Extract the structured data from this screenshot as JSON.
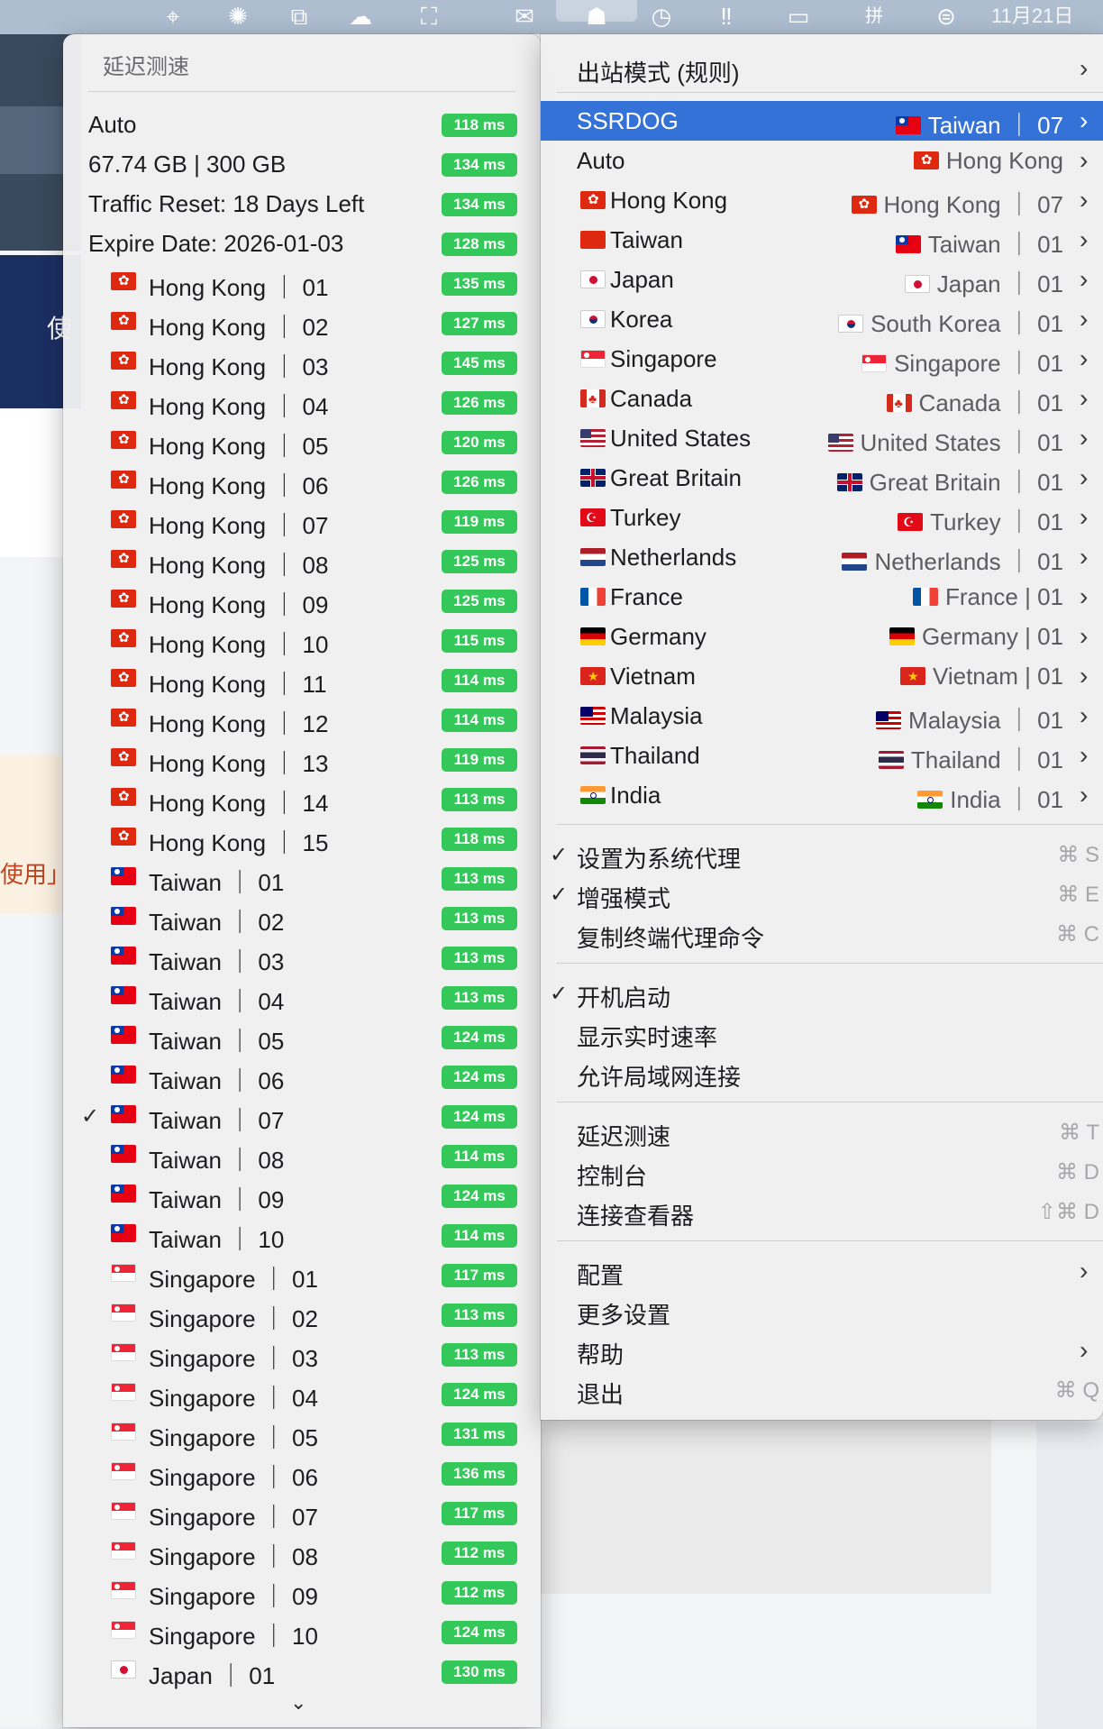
{
  "menubar": {
    "icons": [
      "gps-icon",
      "openai-icon",
      "screenshot-icon",
      "cloud-icon",
      "network-icon",
      "wechat-icon",
      "proxy-app-icon",
      "clock-icon",
      "exclamation-icon",
      "battery-icon",
      "input-method-icon",
      "control-center-icon"
    ],
    "input_method": "拼",
    "clock": "11月21日"
  },
  "background": {
    "nav_char": "使",
    "orange_text": "使用」"
  },
  "left_menu": {
    "header": "延迟测速",
    "items": [
      {
        "name": "Auto",
        "flag": "",
        "latency": "118 ms",
        "checked": false
      },
      {
        "name": "67.74 GB | 300 GB",
        "flag": "",
        "latency": "134 ms",
        "checked": false
      },
      {
        "name": "Traffic Reset: 18 Days Left",
        "flag": "",
        "latency": "134 ms",
        "checked": false
      },
      {
        "name": "Expire Date: 2026-01-03",
        "flag": "",
        "latency": "128 ms",
        "checked": false
      },
      {
        "name": "Hong Kong ｜ 01",
        "flag": "hk",
        "latency": "135 ms",
        "checked": false
      },
      {
        "name": "Hong Kong ｜ 02",
        "flag": "hk",
        "latency": "127 ms",
        "checked": false
      },
      {
        "name": "Hong Kong ｜ 03",
        "flag": "hk",
        "latency": "145 ms",
        "checked": false
      },
      {
        "name": "Hong Kong ｜ 04",
        "flag": "hk",
        "latency": "126 ms",
        "checked": false
      },
      {
        "name": "Hong Kong ｜ 05",
        "flag": "hk",
        "latency": "120 ms",
        "checked": false
      },
      {
        "name": "Hong Kong ｜ 06",
        "flag": "hk",
        "latency": "126 ms",
        "checked": false
      },
      {
        "name": "Hong Kong ｜ 07",
        "flag": "hk",
        "latency": "119 ms",
        "checked": false
      },
      {
        "name": "Hong Kong ｜ 08",
        "flag": "hk",
        "latency": "125 ms",
        "checked": false
      },
      {
        "name": "Hong Kong ｜ 09",
        "flag": "hk",
        "latency": "125 ms",
        "checked": false
      },
      {
        "name": "Hong Kong ｜ 10",
        "flag": "hk",
        "latency": "115 ms",
        "checked": false
      },
      {
        "name": "Hong Kong ｜ 11",
        "flag": "hk",
        "latency": "114 ms",
        "checked": false
      },
      {
        "name": "Hong Kong ｜ 12",
        "flag": "hk",
        "latency": "114 ms",
        "checked": false
      },
      {
        "name": "Hong Kong ｜ 13",
        "flag": "hk",
        "latency": "119 ms",
        "checked": false
      },
      {
        "name": "Hong Kong ｜ 14",
        "flag": "hk",
        "latency": "113 ms",
        "checked": false
      },
      {
        "name": "Hong Kong ｜ 15",
        "flag": "hk",
        "latency": "118 ms",
        "checked": false
      },
      {
        "name": "Taiwan ｜ 01",
        "flag": "tw",
        "latency": "113 ms",
        "checked": false
      },
      {
        "name": "Taiwan ｜ 02",
        "flag": "tw",
        "latency": "113 ms",
        "checked": false
      },
      {
        "name": "Taiwan ｜ 03",
        "flag": "tw",
        "latency": "113 ms",
        "checked": false
      },
      {
        "name": "Taiwan ｜ 04",
        "flag": "tw",
        "latency": "113 ms",
        "checked": false
      },
      {
        "name": "Taiwan ｜ 05",
        "flag": "tw",
        "latency": "124 ms",
        "checked": false
      },
      {
        "name": "Taiwan ｜ 06",
        "flag": "tw",
        "latency": "124 ms",
        "checked": false
      },
      {
        "name": "Taiwan ｜ 07",
        "flag": "tw",
        "latency": "124 ms",
        "checked": true
      },
      {
        "name": "Taiwan ｜ 08",
        "flag": "tw",
        "latency": "114 ms",
        "checked": false
      },
      {
        "name": "Taiwan ｜ 09",
        "flag": "tw",
        "latency": "124 ms",
        "checked": false
      },
      {
        "name": "Taiwan ｜ 10",
        "flag": "tw",
        "latency": "114 ms",
        "checked": false
      },
      {
        "name": "Singapore ｜ 01",
        "flag": "sg",
        "latency": "117 ms",
        "checked": false
      },
      {
        "name": "Singapore ｜ 02",
        "flag": "sg",
        "latency": "113 ms",
        "checked": false
      },
      {
        "name": "Singapore ｜ 03",
        "flag": "sg",
        "latency": "113 ms",
        "checked": false
      },
      {
        "name": "Singapore ｜ 04",
        "flag": "sg",
        "latency": "124 ms",
        "checked": false
      },
      {
        "name": "Singapore ｜ 05",
        "flag": "sg",
        "latency": "131 ms",
        "checked": false
      },
      {
        "name": "Singapore ｜ 06",
        "flag": "sg",
        "latency": "136 ms",
        "checked": false
      },
      {
        "name": "Singapore ｜ 07",
        "flag": "sg",
        "latency": "117 ms",
        "checked": false
      },
      {
        "name": "Singapore ｜ 08",
        "flag": "sg",
        "latency": "112 ms",
        "checked": false
      },
      {
        "name": "Singapore ｜ 09",
        "flag": "sg",
        "latency": "112 ms",
        "checked": false
      },
      {
        "name": "Singapore ｜ 10",
        "flag": "sg",
        "latency": "124 ms",
        "checked": false
      },
      {
        "name": "Japan ｜ 01",
        "flag": "jp",
        "latency": "130 ms",
        "checked": false
      }
    ],
    "scroll_icon": "chevron-down-icon",
    "check_mark": "✓",
    "latency_color": "#34c759"
  },
  "right_menu": {
    "outbound_mode": "出站模式 (规则)",
    "groups": [
      {
        "name": "SSRDOG",
        "flag": "",
        "value": "Taiwan ｜ 07",
        "value_flag": "tw",
        "selected": true
      },
      {
        "name": "Auto",
        "flag": "",
        "value": "Hong Kong",
        "value_flag": "hk",
        "selected": false
      },
      {
        "name": "Hong Kong",
        "flag": "hk",
        "value": "Hong Kong ｜ 07",
        "value_flag": "hk",
        "selected": false
      },
      {
        "name": "Taiwan",
        "flag": "cn",
        "value": "Taiwan ｜ 01",
        "value_flag": "tw",
        "selected": false
      },
      {
        "name": "Japan",
        "flag": "jp",
        "value": "Japan ｜ 01",
        "value_flag": "jp",
        "selected": false
      },
      {
        "name": "Korea",
        "flag": "kr",
        "value": "South Korea ｜ 01",
        "value_flag": "kr",
        "selected": false
      },
      {
        "name": "Singapore",
        "flag": "sg",
        "value": "Singapore ｜ 01",
        "value_flag": "sg",
        "selected": false
      },
      {
        "name": "Canada",
        "flag": "ca",
        "value": "Canada ｜ 01",
        "value_flag": "ca",
        "selected": false
      },
      {
        "name": "United States",
        "flag": "us",
        "value": "United States ｜ 01",
        "value_flag": "us",
        "selected": false
      },
      {
        "name": "Great Britain",
        "flag": "gb",
        "value": "Great Britain ｜ 01",
        "value_flag": "gb",
        "selected": false
      },
      {
        "name": "Turkey",
        "flag": "tr",
        "value": "Turkey ｜ 01",
        "value_flag": "tr",
        "selected": false
      },
      {
        "name": "Netherlands",
        "flag": "nl",
        "value": "Netherlands ｜ 01",
        "value_flag": "nl",
        "selected": false
      },
      {
        "name": "France",
        "flag": "fr",
        "value": "France | 01",
        "value_flag": "fr",
        "selected": false
      },
      {
        "name": "Germany",
        "flag": "de",
        "value": "Germany | 01",
        "value_flag": "de",
        "selected": false
      },
      {
        "name": "Vietnam",
        "flag": "vn",
        "value": "Vietnam | 01",
        "value_flag": "vn",
        "selected": false
      },
      {
        "name": "Malaysia",
        "flag": "my",
        "value": "Malaysia ｜ 01",
        "value_flag": "my",
        "selected": false
      },
      {
        "name": "Thailand",
        "flag": "th",
        "value": "Thailand ｜ 01",
        "value_flag": "th",
        "selected": false
      },
      {
        "name": "India",
        "flag": "in",
        "value": "India ｜ 01",
        "value_flag": "in",
        "selected": false
      }
    ],
    "settings_group1": [
      {
        "label": "设置为系统代理",
        "checked": true,
        "shortcut": "⌘ S"
      },
      {
        "label": "增强模式",
        "checked": true,
        "shortcut": "⌘ E"
      },
      {
        "label": "复制终端代理命令",
        "checked": false,
        "shortcut": "⌘ C"
      }
    ],
    "settings_group2": [
      {
        "label": "开机启动",
        "checked": true,
        "shortcut": ""
      },
      {
        "label": "显示实时速率",
        "checked": false,
        "shortcut": ""
      },
      {
        "label": "允许局域网连接",
        "checked": false,
        "shortcut": ""
      }
    ],
    "tools_group": [
      {
        "label": "延迟测速",
        "shortcut": "⌘ T"
      },
      {
        "label": "控制台",
        "shortcut": "⌘ D"
      },
      {
        "label": "连接查看器",
        "shortcut": "⇧⌘ D"
      }
    ],
    "misc_group": [
      {
        "label": "配置",
        "submenu": true,
        "shortcut": ""
      },
      {
        "label": "更多设置",
        "submenu": false,
        "shortcut": ""
      },
      {
        "label": "帮助",
        "submenu": true,
        "shortcut": ""
      },
      {
        "label": "退出",
        "submenu": false,
        "shortcut": "⌘ Q"
      }
    ],
    "submenu_arrow": "›",
    "selected_color": "#3572d8"
  }
}
